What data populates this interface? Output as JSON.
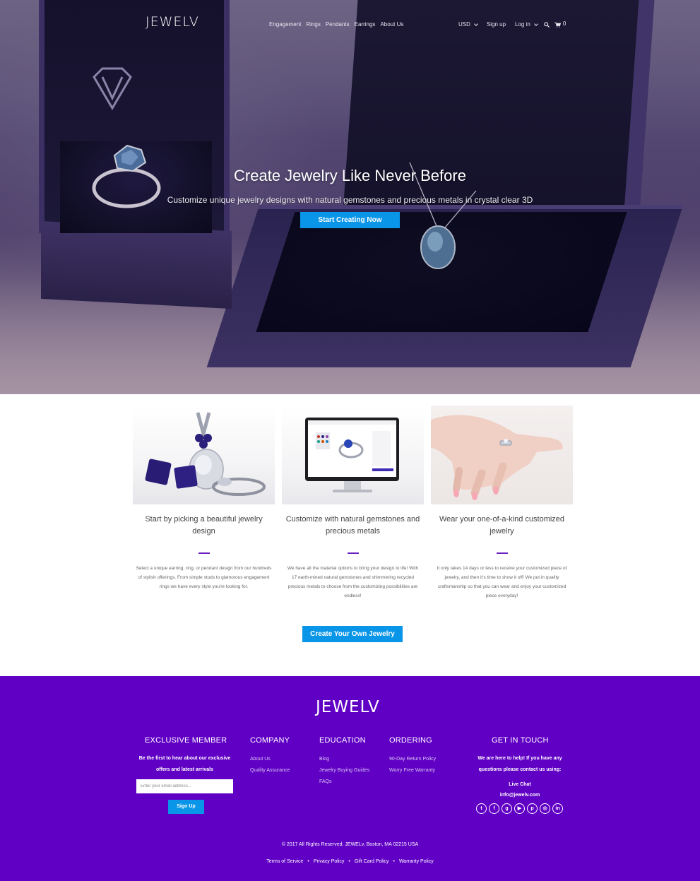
{
  "nav": {
    "logo": "JEWELV",
    "links": [
      "Engagement",
      "Rings",
      "Pendants",
      "Earrings",
      "About Us"
    ],
    "currency": "USD",
    "signup": "Sign up",
    "login": "Log in",
    "cart_count": "0"
  },
  "hero": {
    "title": "Create Jewelry Like Never Before",
    "subtitle": "Customize unique jewelry designs with natural gemstones and precious metals in crystal clear 3D",
    "button": "Start Creating Now"
  },
  "features": [
    {
      "title": "Start by picking a beautiful jewelry design",
      "text": "Select a unique earring, ring, or pendant design from our hundreds of stylish offerings. From simple studs to glamorous engagement rings we have every style you're looking for."
    },
    {
      "title": "Customize with natural gemstones and precious metals",
      "text": "We have all the material options to bring your design to life! With 17 earth-mined natural gemstones and shimmering recycled precious metals to choose from the customizing possibilities are endless!"
    },
    {
      "title": "Wear your one-of-a-kind customized jewelry",
      "text": "It only takes 14 days or less to receive your customized piece of jewelry, and then it's time to show it off! We put in quality craftsmanship so that you can wear and enjoy your customized piece everyday!"
    }
  ],
  "cta": {
    "button": "Create Your Own Jewelry"
  },
  "footer": {
    "logo": "JEWELV",
    "exclusive": {
      "title": "EXCLUSIVE MEMBER",
      "text": "Be the first to hear about our exclusive offers and latest arrivals",
      "placeholder": "Enter your email address...",
      "button": "Sign Up"
    },
    "company": {
      "title": "COMPANY",
      "links": [
        "About Us",
        "Quality Assurance"
      ]
    },
    "education": {
      "title": "EDUCATION",
      "links": [
        "Blog",
        "Jewelry Buying Guides",
        "FAQs"
      ]
    },
    "ordering": {
      "title": "ORDERING",
      "links": [
        "90-Day Return Policy",
        "Worry Free Warranty"
      ]
    },
    "contact": {
      "title": "GET IN TOUCH",
      "text": "We are here to help! If you have any questions please contact us using:",
      "live_chat": "Live Chat",
      "email": "info@jewelv.com"
    },
    "socials": [
      "twitter-icon",
      "facebook-icon",
      "google-plus-icon",
      "youtube-icon",
      "pinterest-icon",
      "instagram-icon",
      "linkedin-icon"
    ],
    "copyright": "© 2017 All Rights Reserved. JEWELv, Boston, MA 02215 USA",
    "legal": [
      "Terms of Service",
      "Privacy Policy",
      "Gift Card Policy",
      "Warranty Policy"
    ]
  },
  "colors": {
    "accent": "#0a96e8",
    "footer_bg": "#6100c5",
    "divider": "#6a1fc2"
  }
}
